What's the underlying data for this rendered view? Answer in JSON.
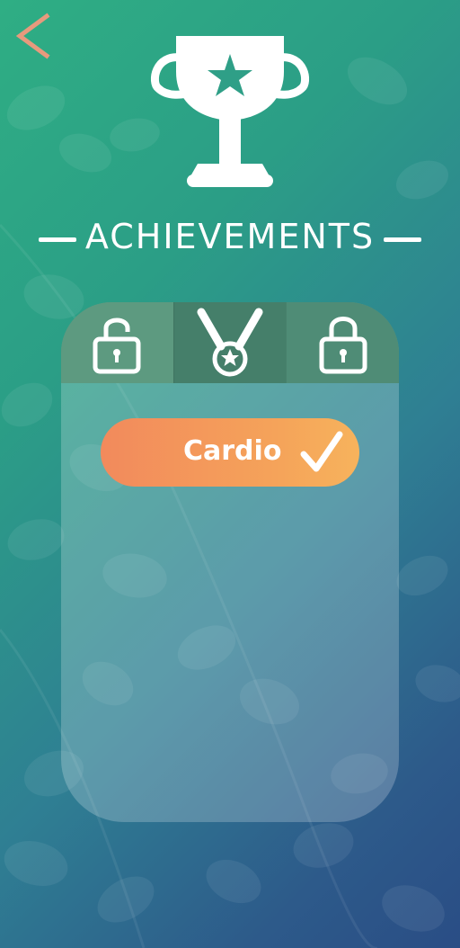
{
  "header": {
    "title": "ACHIEVEMENTS",
    "back_icon": "chevron-left-icon",
    "trophy_icon": "trophy-icon"
  },
  "tabs": [
    {
      "icon": "unlock-icon",
      "state": "unlocked"
    },
    {
      "icon": "medal-icon",
      "state": "selected"
    },
    {
      "icon": "lock-icon",
      "state": "locked"
    }
  ],
  "achievements": [
    {
      "label": "Cardio",
      "icon": "check-icon",
      "completed": true
    }
  ],
  "colors": {
    "back_arrow": "#e79a7d",
    "tab_bar": "#4e8e78",
    "pill_start": "#f28a5c",
    "pill_end": "#f7b35c"
  }
}
